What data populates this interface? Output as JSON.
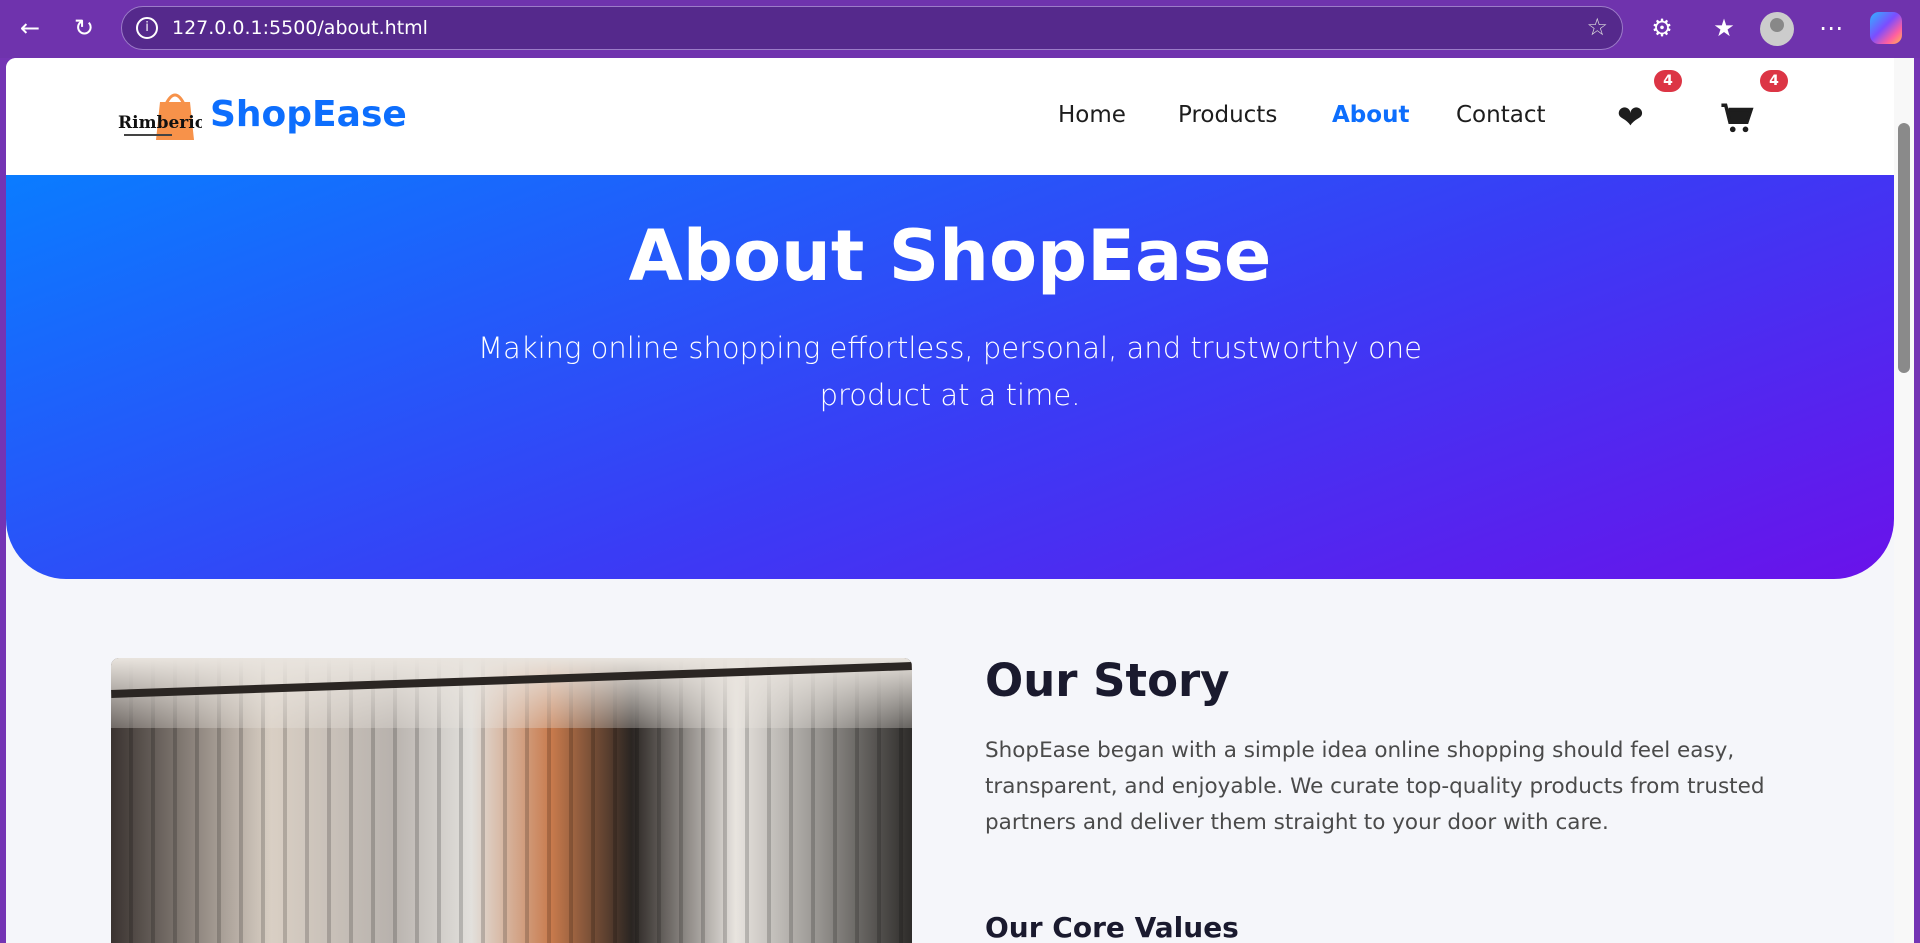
{
  "browser": {
    "url": "127.0.0.1:5500/about.html"
  },
  "nav": {
    "logo_text": "Rimberio",
    "brand": "ShopEase",
    "links": [
      {
        "label": "Home"
      },
      {
        "label": "Products"
      },
      {
        "label": "About"
      },
      {
        "label": "Contact"
      }
    ],
    "wishlist_count": "4",
    "cart_count": "4"
  },
  "hero": {
    "title": "About ShopEase",
    "subtitle": "Making online shopping effortless, personal, and trustworthy one product at a time."
  },
  "story": {
    "title": "Our Story",
    "text": "ShopEase began with a simple idea online shopping should feel easy, transparent, and enjoyable. We curate top-quality products from trusted partners and deliver them straight to your door with care.",
    "core_values_title": "Our Core Values"
  },
  "colors": {
    "accent": "#0d6efd",
    "badge": "#dc3545",
    "hero_start": "#0a7cff",
    "hero_end": "#6a12ea"
  }
}
